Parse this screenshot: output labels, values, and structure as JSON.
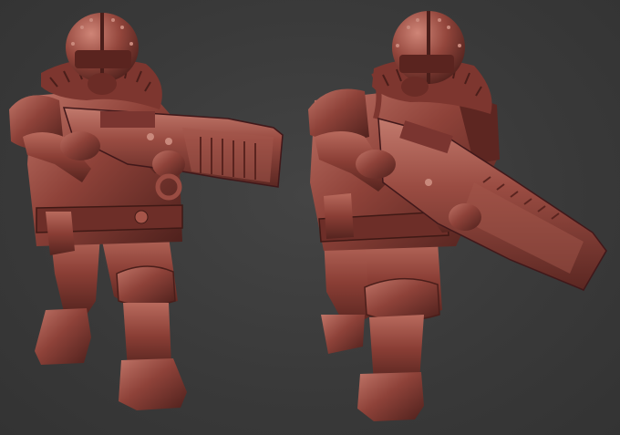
{
  "scene": {
    "background_color": "#3a3a3a",
    "model_color": "#8a3f37",
    "model_highlight": "#b96b5f",
    "model_shadow": "#4a1f1b",
    "models": [
      {
        "name": "soldier-front-view",
        "icon": "sculpt-figure"
      },
      {
        "name": "soldier-three-quarter-view",
        "icon": "sculpt-figure"
      }
    ]
  }
}
